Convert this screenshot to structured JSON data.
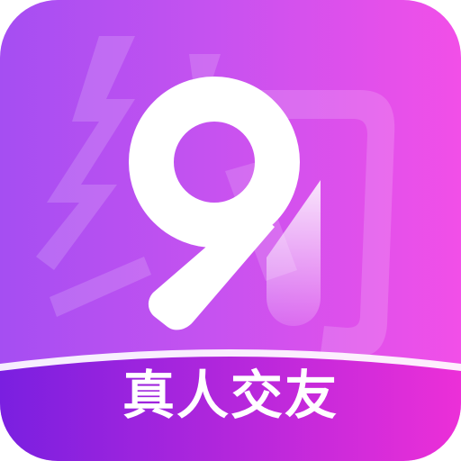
{
  "icon": {
    "logo_mark": "9/1-logo",
    "watermark_glyph": "约",
    "tagline": "真人交友"
  },
  "colors": {
    "gradient_left": "#a54ef2",
    "gradient_right": "#f24fe8",
    "band_left": "#7a1fe0",
    "band_right": "#ec2fd8",
    "logo_white": "#ffffff"
  }
}
